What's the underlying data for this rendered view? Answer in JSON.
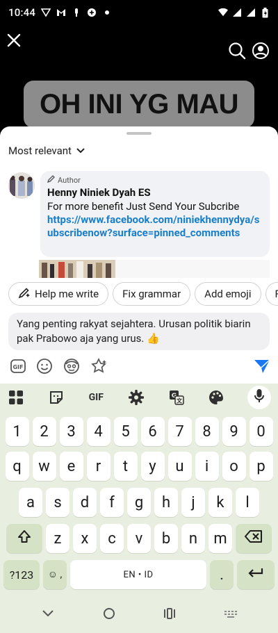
{
  "status": {
    "time": "10:44"
  },
  "video": {
    "caption": "OH INI YG MAU"
  },
  "comments": {
    "sort_label": "Most relevant",
    "pinned": {
      "author_tag": "Author",
      "name": "Henny Niniek Dyah ES",
      "text": "For more benefit Just Send Your Subcribe",
      "link": "https://www.facebook.com/niniekhennydya/subscribenow?surface=pinned_comments"
    }
  },
  "suggestions": [
    {
      "label": "Help me write",
      "icon": "pen-sparkle-icon"
    },
    {
      "label": "Fix grammar"
    },
    {
      "label": "Add emoji"
    },
    {
      "label": "Fu"
    }
  ],
  "composer": {
    "text": "Yang penting rakyat sejahtera. Urusan politik biarin pak Prabowo aja yang urus. 👍"
  },
  "keyboard": {
    "toolbar_gif": "GIF",
    "row1": [
      "1",
      "2",
      "3",
      "4",
      "5",
      "6",
      "7",
      "8",
      "9",
      "0"
    ],
    "row2": [
      "q",
      "w",
      "e",
      "r",
      "t",
      "y",
      "u",
      "i",
      "o",
      "p"
    ],
    "row3": [
      "a",
      "s",
      "d",
      "f",
      "g",
      "h",
      "j",
      "k",
      "l"
    ],
    "row4": [
      "z",
      "x",
      "c",
      "v",
      "b",
      "n",
      "m"
    ],
    "symbols_label": "?123",
    "emoji_label": "☺ ,",
    "space_label": "EN • ID",
    "period_label": "."
  },
  "colors": {
    "accent": "#1a7fcb",
    "send": "#1877f2",
    "keyboard_bg": "#e8eee0",
    "func_key": "#d5e2c6"
  }
}
